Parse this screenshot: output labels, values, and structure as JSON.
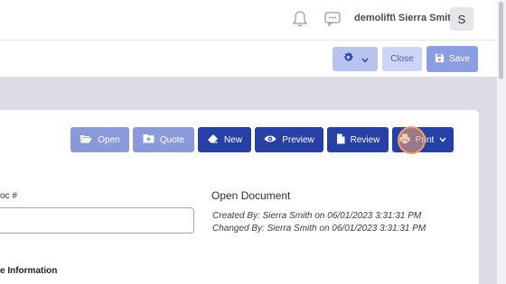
{
  "header": {
    "user_label": "demolift\\ Sierra Smith",
    "avatar_initial": "S"
  },
  "toolbar": {
    "close_label": "Close",
    "save_label": "Save"
  },
  "actions": {
    "open_label": "Open",
    "quote_label": "Quote",
    "new_label": "New",
    "preview_label": "Preview",
    "review_label": "Review",
    "print_label": "Print"
  },
  "form": {
    "doc_label": "oc #",
    "doc_value": "",
    "section_title": "e Information"
  },
  "document": {
    "title": "Open Document",
    "created": "Created By: Sierra Smith on 06/01/2023 3:31:31 PM",
    "changed": "Changed By: Sierra Smith on 06/01/2023 3:31:31 PM"
  },
  "colors": {
    "primary": "#2740a5",
    "primary_light": "#8a99d9",
    "background": "#dcdce6",
    "highlight": "#f2a060"
  },
  "icons": {
    "bell": "bell-icon",
    "chat": "chat-icon",
    "gear": "gear-icon",
    "save": "floppy-icon",
    "open": "folder-open-icon",
    "quote": "folder-plus-icon",
    "new": "eraser-icon",
    "preview": "eye-icon",
    "review": "file-icon",
    "print": "printer-icon"
  }
}
